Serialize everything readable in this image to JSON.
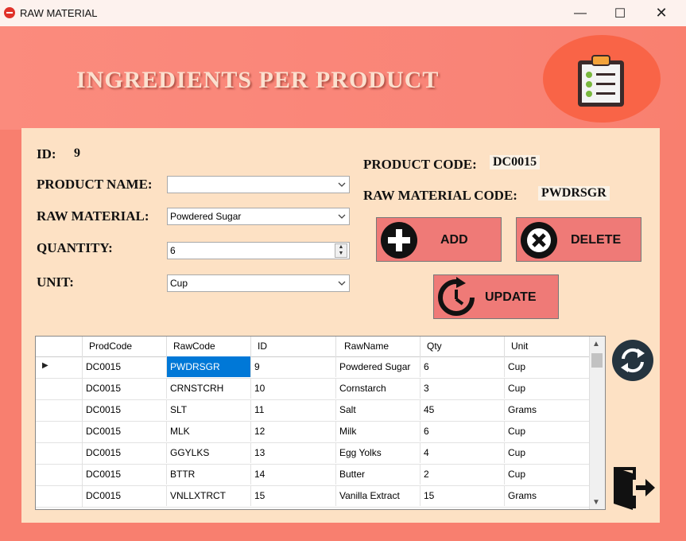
{
  "window": {
    "title": "RAW MATERIAL",
    "min": "—",
    "max": "☐",
    "close": "✕"
  },
  "header": {
    "title": "INGREDIENTS PER PRODUCT",
    "logo_icon": "clipboard-checklist-icon"
  },
  "form": {
    "id_label": "ID:",
    "id_value": "9",
    "product_name_label": "PRODUCT NAME:",
    "product_name_value": "",
    "raw_material_label": "RAW MATERIAL:",
    "raw_material_value": "Powdered Sugar",
    "quantity_label": "QUANTITY:",
    "quantity_value": "6",
    "unit_label": "UNIT:",
    "unit_value": "Cup",
    "product_code_label": "PRODUCT CODE:",
    "product_code_value": "DC0015",
    "raw_material_code_label": "RAW MATERIAL CODE:",
    "raw_material_code_value": "PWDRSGR"
  },
  "buttons": {
    "add": "ADD",
    "delete": "DELETE",
    "update": "UPDATE"
  },
  "grid": {
    "columns": [
      "ProdCode",
      "RawCode",
      "ID",
      "RawName",
      "Qty",
      "Unit"
    ],
    "rows": [
      [
        "DC0015",
        "PWDRSGR",
        "9",
        "Powdered Sugar",
        "6",
        "Cup"
      ],
      [
        "DC0015",
        "CRNSTCRH",
        "10",
        "Cornstarch",
        "3",
        "Cup"
      ],
      [
        "DC0015",
        "SLT",
        "11",
        "Salt",
        "45",
        "Grams"
      ],
      [
        "DC0015",
        "MLK",
        "12",
        "Milk",
        "6",
        "Cup"
      ],
      [
        "DC0015",
        "GGYLKS",
        "13",
        "Egg Yolks",
        "4",
        "Cup"
      ],
      [
        "DC0015",
        "BTTR",
        "14",
        "Butter",
        "2",
        "Cup"
      ],
      [
        "DC0015",
        "VNLLXTRCT",
        "15",
        "Vanilla Extract",
        "15",
        "Grams"
      ]
    ],
    "current_row_marker": "▶"
  },
  "colors": {
    "background": "#f87f6f",
    "panel": "#fde1c4",
    "button": "#ef7a77",
    "selection": "#0078d7"
  }
}
